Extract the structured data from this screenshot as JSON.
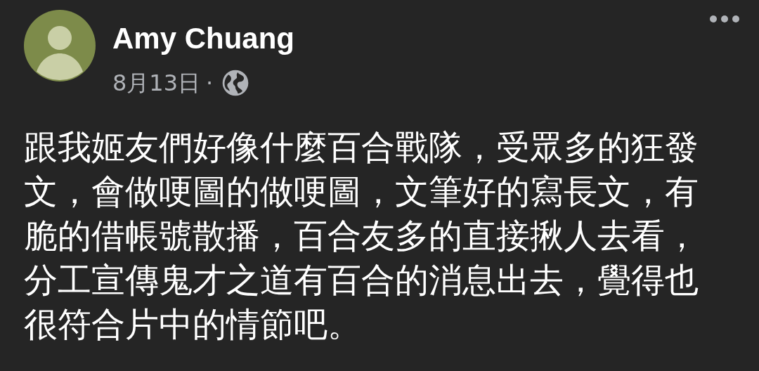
{
  "post": {
    "author": "Amy Chuang",
    "date": "8月13日",
    "separator": "·",
    "audience_icon": {
      "kind": "globe"
    },
    "body": "跟我姬友們好像什麼百合戰隊，受眾多的狂發文，會做哽圖的做哽圖，文筆好的寫長文，有脆的借帳號散播，百合友多的直接揪人去看，分工宣傳鬼才之道有百合的消息出去，覺得也很符合片中的情節吧。"
  }
}
